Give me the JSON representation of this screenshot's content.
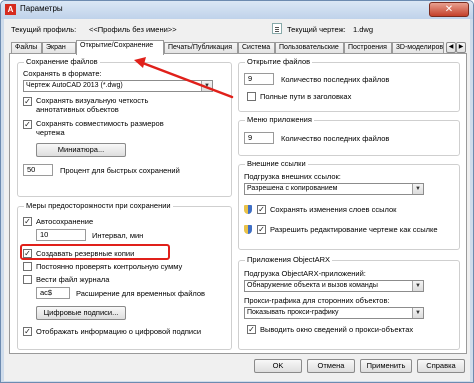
{
  "window": {
    "title": "Параметры",
    "app_icon_letter": "A",
    "close_glyph": "✕"
  },
  "profile": {
    "label": "Текущий профиль:",
    "value": "<<Профиль без имени>>",
    "drawing_label": "Текущий чертеж:",
    "drawing_value": "1.dwg"
  },
  "tabs": [
    {
      "label": "Файлы"
    },
    {
      "label": "Экран"
    },
    {
      "label": "Открытие/Сохранение"
    },
    {
      "label": "Печать/Публикация"
    },
    {
      "label": "Система"
    },
    {
      "label": "Пользовательские"
    },
    {
      "label": "Построения"
    },
    {
      "label": "3D-моделиров"
    }
  ],
  "tab_scroll": {
    "left": "◀",
    "right": "▶"
  },
  "file_save": {
    "title": "Сохранение файлов",
    "format_label": "Сохранять в формате:",
    "format_value": "Чертеж AutoCAD 2013 (*.dwg)",
    "cb_visual_fidelity": "Сохранять визуальную четкость аннотативных объектов",
    "cb_visual_fidelity_l1": "Сохранять визуальную четкость",
    "cb_visual_fidelity_l2": "аннотативных объектов",
    "cb_size_compat_l1": "Сохранять совместимость размеров",
    "cb_size_compat_l2": "чертежа",
    "thumbnail_button": "Миниатюра...",
    "incremental_value": "50",
    "incremental_label": "Процент для быстрых сохранений"
  },
  "safety": {
    "title": "Меры предосторожности при сохранении",
    "autosave_label": "Автосохранение",
    "interval_value": "10",
    "interval_label": "Интервал, мин",
    "backup_label": "Создавать резервные копии",
    "crc_label": "Постоянно проверять контрольную сумму",
    "log_label": "Вести файл журнала",
    "extension_value": "ac$",
    "extension_label": "Расширение для временных файлов",
    "signatures_button": "Цифровые подписи...",
    "show_sig_label": "Отображать информацию о цифровой подписи"
  },
  "file_open": {
    "title": "Открытие файлов",
    "recent_value": "9",
    "recent_label": "Количество последних файлов",
    "full_path_label": "Полные пути в заголовках"
  },
  "app_menu": {
    "title": "Меню приложения",
    "recent_value": "9",
    "recent_label": "Количество последних файлов"
  },
  "xrefs": {
    "title": "Внешние ссылки",
    "demand_label": "Подгрузка внешних ссылок:",
    "demand_value": "Разрешена с копированием",
    "retain_label": "Сохранять изменения слоев ссылок",
    "allow_edit_label": "Разрешить редактирование чертеже как ссылке"
  },
  "objectarx": {
    "title": "Приложения ObjectARX",
    "load_label": "Подгрузка ObjectARX-приложений:",
    "load_value": "Обнаружение объекта и вызов команды",
    "proxy_label": "Прокси-графика для сторонних объектов:",
    "proxy_value": "Показывать прокси-графику",
    "proxy_info_label": "Выводить окно сведений о прокси-объектах"
  },
  "footer": {
    "ok": "OK",
    "cancel": "Отмена",
    "apply": "Применить",
    "help": "Справка"
  },
  "glyphs": {
    "check": "✓",
    "dropdown": "▼"
  },
  "colors": {
    "highlight": "#e0201a",
    "selection": "#3399ff",
    "window_frame": "#cfdceb"
  }
}
